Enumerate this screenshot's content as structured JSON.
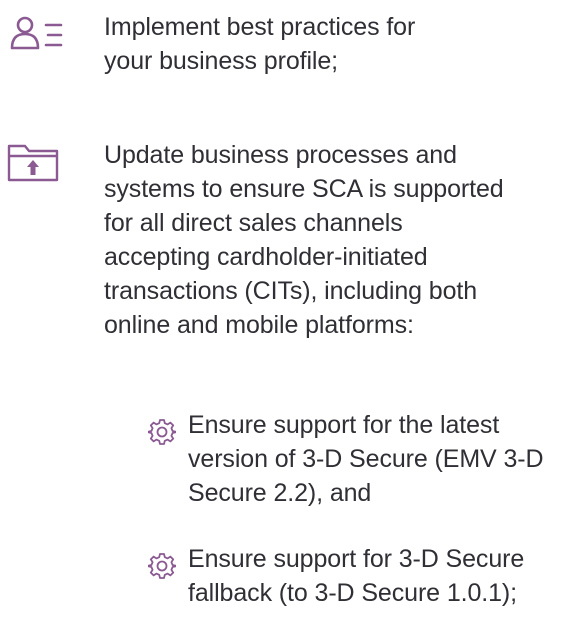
{
  "colors": {
    "icon_accent": "#8b5a93",
    "text": "#2f2f35"
  },
  "items": [
    {
      "icon": "profile-list-icon",
      "lines": [
        "Implement best practices for",
        "your business profile;"
      ]
    },
    {
      "icon": "folder-upload-icon",
      "lines": [
        "Update business processes and",
        "systems to ensure SCA is supported",
        "for all direct sales channels",
        "accepting cardholder-initiated",
        "transactions (CITs), including both",
        "online and mobile platforms:"
      ],
      "subitems": [
        {
          "icon": "gear-icon",
          "lines": [
            "Ensure support for the latest",
            "version of 3-D Secure (EMV 3-D",
            "Secure 2.2), and"
          ]
        },
        {
          "icon": "gear-icon",
          "lines": [
            "Ensure support for 3-D Secure",
            "fallback (to 3-D Secure 1.0.1);"
          ]
        }
      ]
    }
  ]
}
